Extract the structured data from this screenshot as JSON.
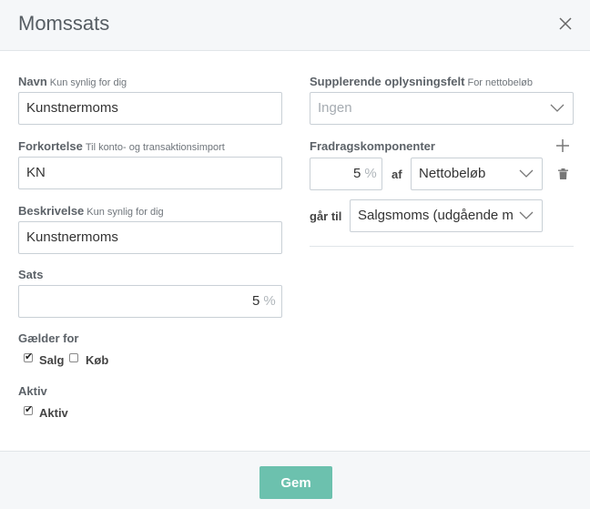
{
  "dialog": {
    "title": "Momssats"
  },
  "form": {
    "name": {
      "label": "Navn",
      "hint": "Kun synlig for dig",
      "value": "Kunstnermoms"
    },
    "abbreviation": {
      "label": "Forkortelse",
      "hint": "Til konto- og transaktionsimport",
      "value": "KN"
    },
    "description": {
      "label": "Beskrivelse",
      "hint": "Kun synlig for dig",
      "value": "Kunstnermoms"
    },
    "rate": {
      "label": "Sats",
      "value": "5",
      "unit": "%"
    },
    "applies_for": {
      "label": "Gælder for",
      "options": [
        {
          "label": "Salg",
          "checked": true
        },
        {
          "label": "Køb",
          "checked": false
        }
      ]
    },
    "active": {
      "label": "Aktiv",
      "checkbox_label": "Aktiv",
      "checked": true
    }
  },
  "supplementary": {
    "label": "Supplerende oplysningsfelt",
    "hint": "For nettobeløb",
    "placeholder": "Ingen"
  },
  "deduction": {
    "label": "Fradragskomponenter",
    "percent": "5",
    "unit": "%",
    "of_label": "af",
    "base": "Nettobeløb",
    "to_label": "går til",
    "target": "Salgsmoms (udgående m"
  },
  "footer": {
    "save_label": "Gem"
  },
  "icons": {
    "close": "close-icon",
    "add": "plus-icon",
    "delete": "trash-icon",
    "dropdown": "chevron-down-icon"
  },
  "colors": {
    "primary": "#6cc1ae",
    "header_bg": "#f5f7f9",
    "border": "#c9d0d6"
  }
}
